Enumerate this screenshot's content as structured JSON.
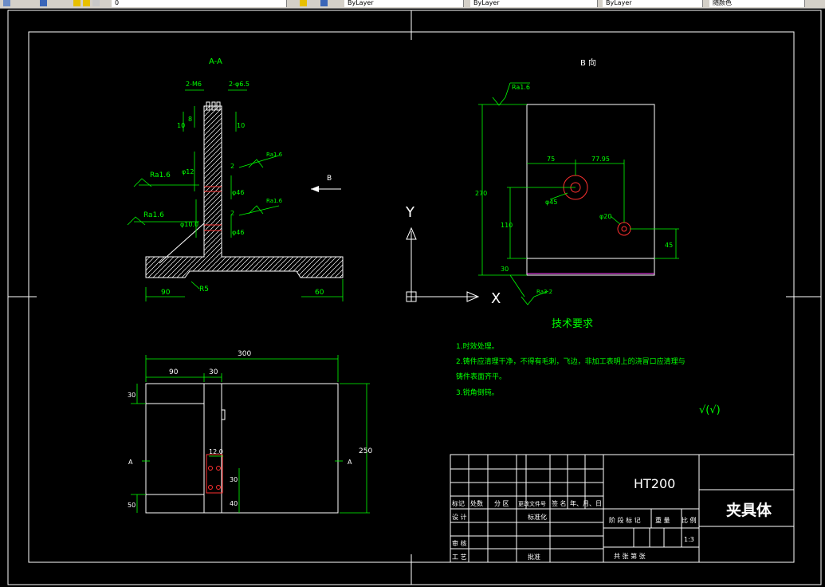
{
  "toolbar": {
    "layer_field": "0",
    "dropdowns": [
      "ByLayer",
      "ByLayer",
      "ByLayer",
      "随颜色"
    ]
  },
  "section_aa": {
    "title": "A-A",
    "dims": [
      "2-M6",
      "2-φ6.5",
      "8",
      "10",
      "10",
      "φ12",
      "φ46",
      "φ46",
      "φ10.0",
      "90",
      "R5",
      "60",
      "2",
      "2"
    ],
    "roughness": [
      "Ra1.6",
      "Ra1.6",
      "Ra1.6",
      "Ra1.6"
    ]
  },
  "b_view": {
    "title": "B 向",
    "dims": [
      "75",
      "77.95",
      "270",
      "110",
      "30",
      "45",
      "φ45",
      "φ20"
    ],
    "roughness": [
      "Ra1.6",
      "Ra3.2"
    ],
    "arrow_label": "B"
  },
  "axes": {
    "x": "X",
    "y": "Y"
  },
  "tech_req": {
    "heading": "技术要求",
    "lines": [
      "1.时效处理。",
      "2.铸件应清理干净，不得有毛刺，飞边，非加工表明上的浇冒口应清理与",
      "铸件表面齐平。",
      "3.锐角倒钝。"
    ],
    "symbol": "√(√)"
  },
  "bottom_view": {
    "dims": [
      "300",
      "90",
      "30",
      "30",
      "250",
      "50",
      "12.0",
      "30",
      "40"
    ],
    "section_marks": [
      "A",
      "A"
    ]
  },
  "title_block": {
    "material": "HT200",
    "part_name": "夹具体",
    "scale": "1:3",
    "row_labels": [
      "标记",
      "处数",
      "分 区",
      "更改文件号",
      "签 名",
      "年、月、日"
    ],
    "design": "设 计",
    "standardize": "标准化",
    "review": "审 核",
    "process": "工 艺",
    "approve": "批准",
    "stage": "阶 段 标 记",
    "weight": "重 量",
    "ratio": "比 例",
    "sheets": "共    张  第    张"
  }
}
